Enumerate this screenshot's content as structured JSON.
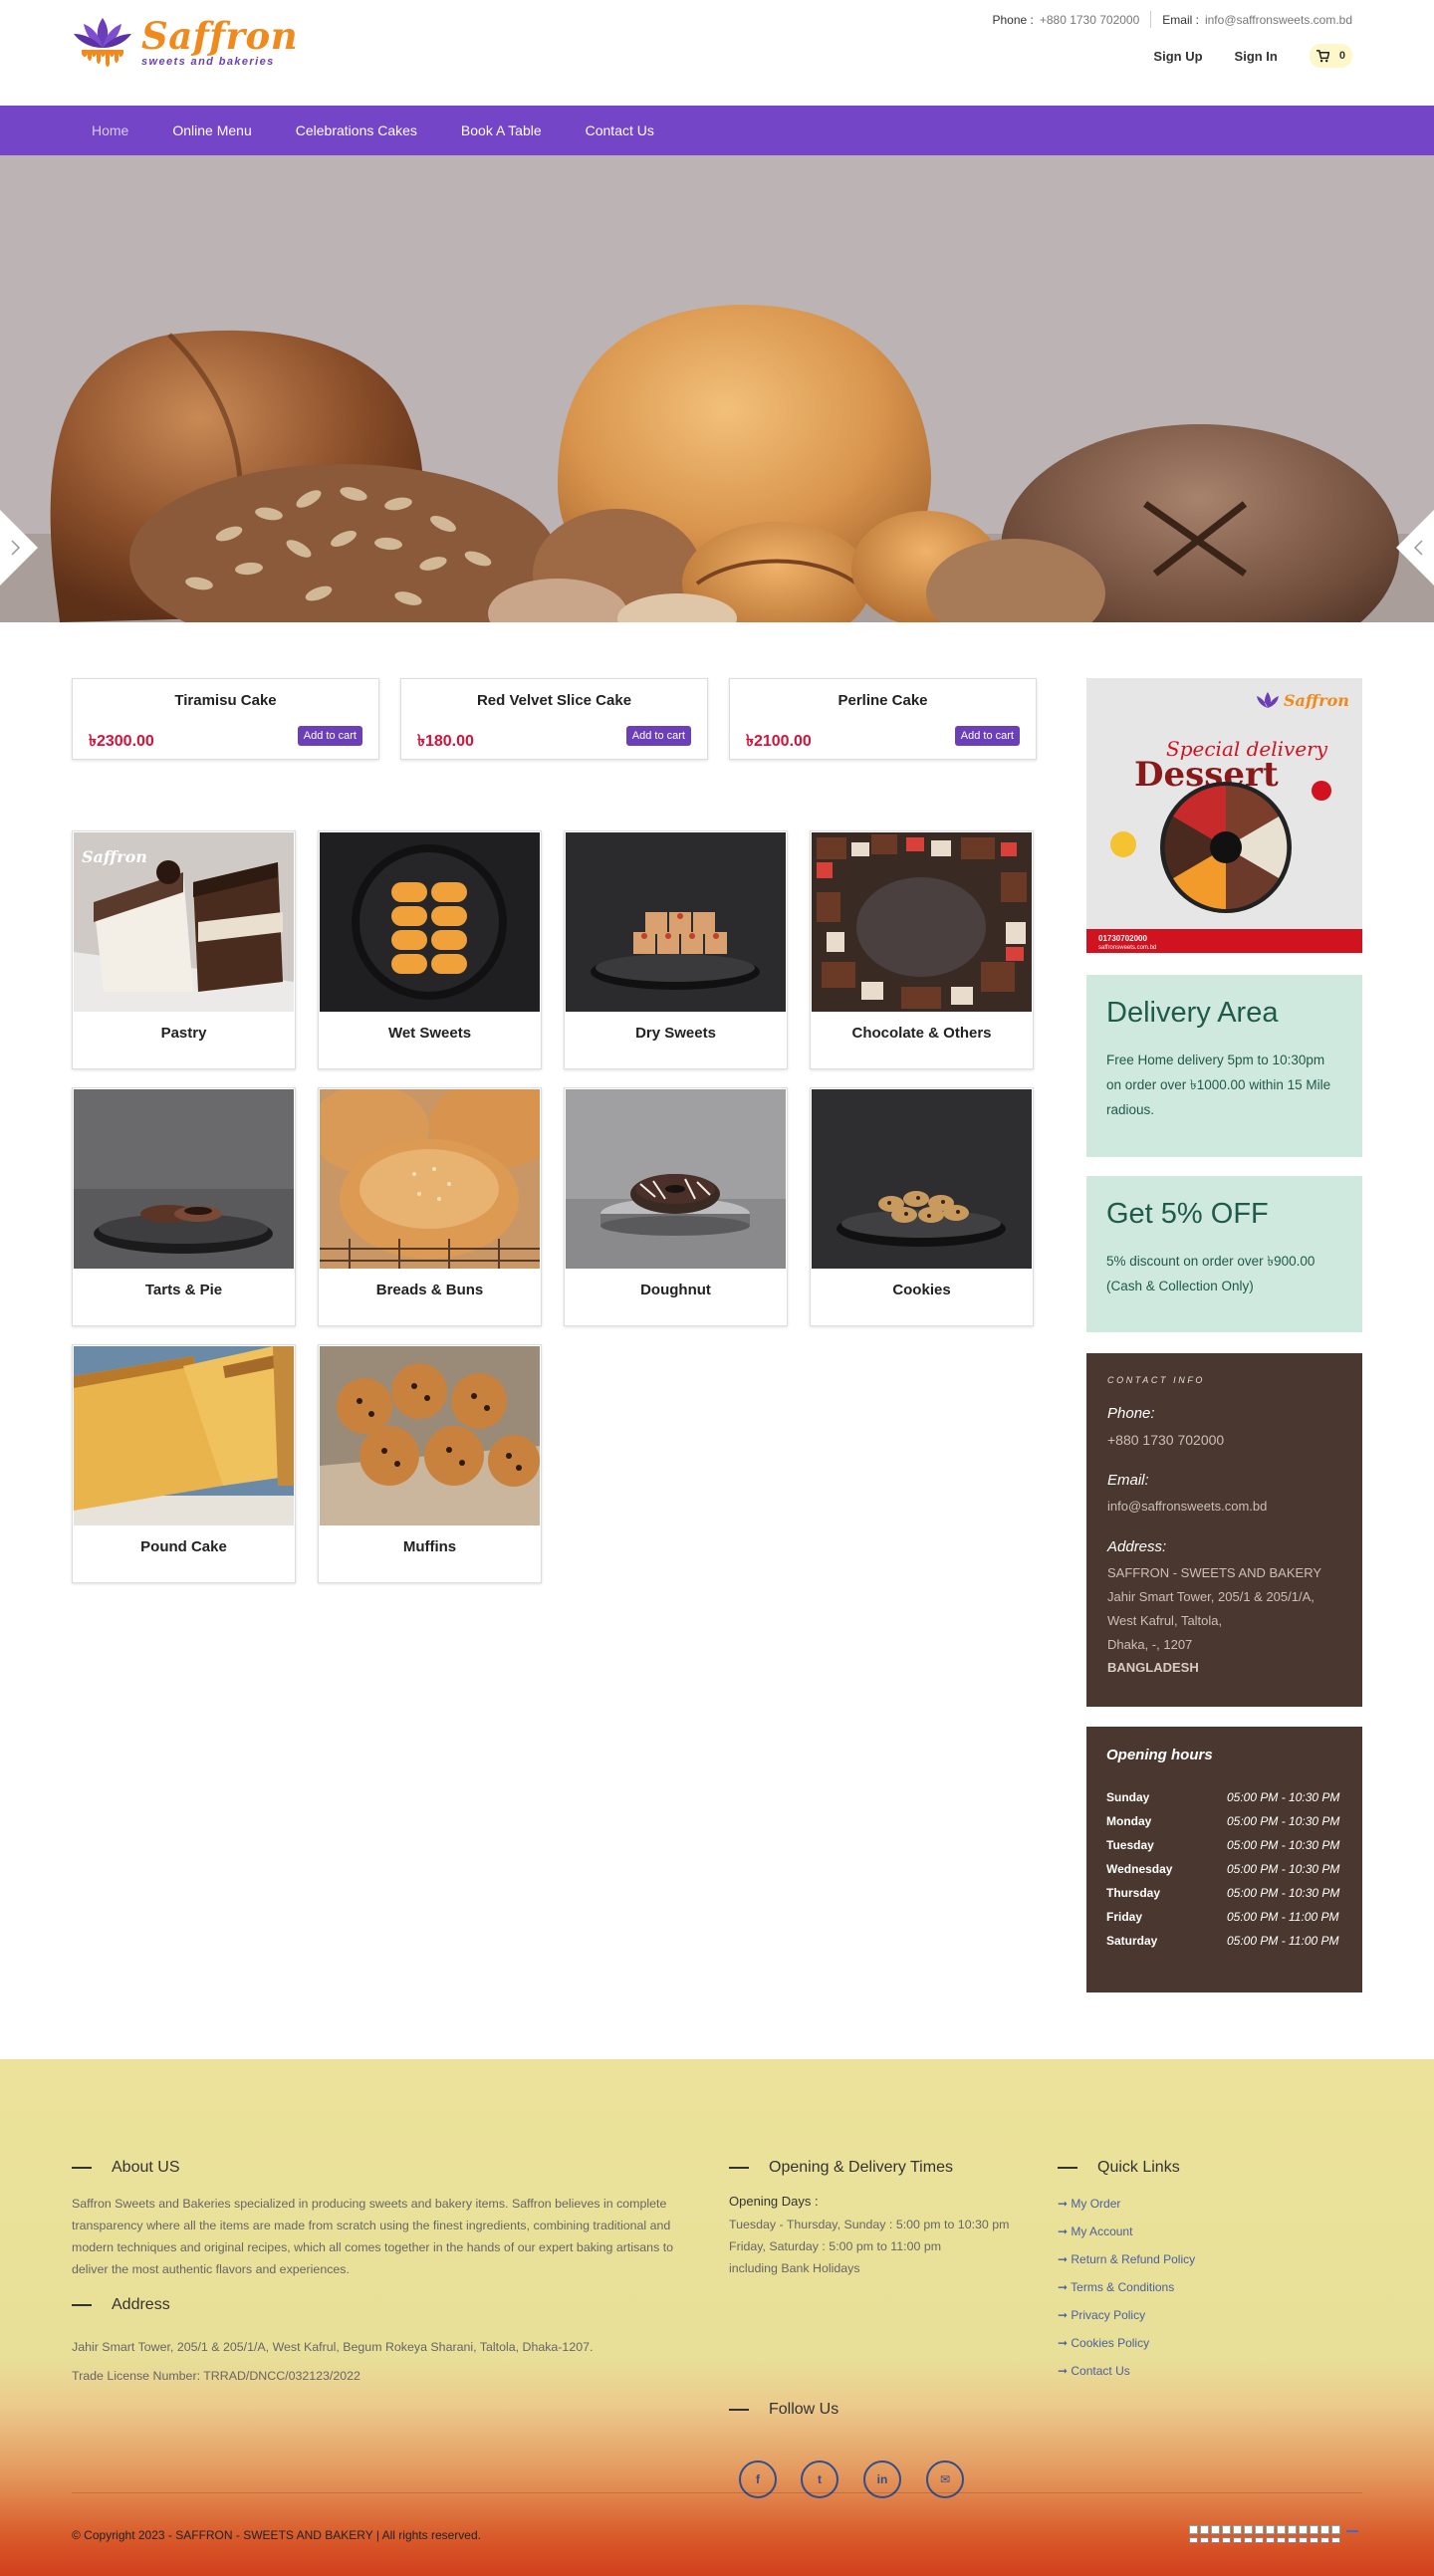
{
  "brand": {
    "name": "Saffron",
    "tagline": "sweets and bakeries"
  },
  "topbar": {
    "phone_label": "Phone :",
    "phone_value": "+880 1730 702000",
    "email_label": "Email :",
    "email_value": "info@saffronsweets.com.bd"
  },
  "account": {
    "signup": "Sign Up",
    "signin": "Sign In",
    "cart_count": "0",
    "cart_icon": "cart-icon"
  },
  "nav": [
    "Home",
    "Online Menu",
    "Celebrations Cakes",
    "Book A Table",
    "Contact Us"
  ],
  "hero": {
    "prev_icon": "chevron-right-icon",
    "next_icon": "chevron-left-icon"
  },
  "featured": [
    {
      "name": "Tiramisu Cake",
      "price": "৳2300.00",
      "button": "Add to cart"
    },
    {
      "name": "Red Velvet Slice Cake",
      "price": "৳180.00",
      "button": "Add to cart"
    },
    {
      "name": "Perline Cake",
      "price": "৳2100.00",
      "button": "Add to cart"
    }
  ],
  "categories": [
    "Pastry",
    "Wet Sweets",
    "Dry Sweets",
    "Chocolate & Others",
    "Tarts & Pie",
    "Breads & Buns",
    "Doughnut",
    "Cookies",
    "Pound Cake",
    "Muffins"
  ],
  "promo": {
    "title": "Special delivery",
    "headline": "Dessert",
    "phone": "01730702000",
    "site": "saffronsweets.com.bd",
    "brand": "Saffron"
  },
  "delivery": {
    "title": "Delivery Area",
    "text": "Free Home delivery 5pm to 10:30pm on order over ৳1000.00 within 15 Mile radious."
  },
  "discount": {
    "title": "Get 5% OFF",
    "text": "5% discount on order over ৳900.00 (Cash & Collection Only)"
  },
  "contact": {
    "heading": "CONTACT INFO",
    "phone_label": "Phone:",
    "phone": "+880 1730 702000",
    "email_label": "Email:",
    "email": "info@saffronsweets.com.bd",
    "address_label": "Address:",
    "address_lines": [
      "SAFFRON - SWEETS AND BAKERY",
      "Jahir Smart Tower, 205/1 & 205/1/A,",
      "West Kafrul, Taltola,",
      "Dhaka, -, 1207"
    ],
    "country": "BANGLADESH"
  },
  "hours": {
    "title": "Opening hours",
    "rows": [
      {
        "day": "Sunday",
        "time": "05:00 PM - 10:30 PM"
      },
      {
        "day": "Monday",
        "time": "05:00 PM - 10:30 PM"
      },
      {
        "day": "Tuesday",
        "time": "05:00 PM - 10:30 PM"
      },
      {
        "day": "Wednesday",
        "time": "05:00 PM - 10:30 PM"
      },
      {
        "day": "Thursday",
        "time": "05:00 PM - 10:30 PM"
      },
      {
        "day": "Friday",
        "time": "05:00 PM - 11:00 PM"
      },
      {
        "day": "Saturday",
        "time": "05:00 PM - 11:00 PM"
      }
    ]
  },
  "footer": {
    "about_title": "About US",
    "about_text": "Saffron Sweets and Bakeries specialized in producing sweets and bakery items. Saffron believes in complete transparency where all the items are made from scratch using the finest ingredients, combining traditional and modern techniques and original recipes, which all comes together in the hands of our expert baking artisans to deliver the most authentic flavors and experiences.",
    "address_title": "Address",
    "address_text": "Jahir Smart Tower, 205/1 & 205/1/A, West Kafrul, Begum Rokeya Sharani, Taltola, Dhaka-1207.",
    "license": "Trade License Number: TRRAD/DNCC/032123/2022",
    "times_title": "Opening & Delivery Times",
    "opening_days": "Opening Days :",
    "times_lines": [
      "Tuesday - Thursday, Sunday : 5:00 pm to 10:30 pm",
      "Friday, Saturday : 5:00 pm to 11:00 pm",
      "including Bank Holidays"
    ],
    "links_title": "Quick Links",
    "links": [
      "My Order",
      "My Account",
      "Return & Refund Policy",
      "Terms & Conditions",
      "Privacy Policy",
      "Cookies Policy",
      "Contact Us"
    ],
    "follow_title": "Follow Us",
    "social": [
      {
        "icon": "facebook-icon",
        "glyph": "f"
      },
      {
        "icon": "twitter-icon",
        "glyph": "t"
      },
      {
        "icon": "linkedin-icon",
        "glyph": "in"
      },
      {
        "icon": "email-icon",
        "glyph": "✉"
      }
    ],
    "copyright": "© Copyright 2023 - SAFFRON - SWEETS AND BAKERY | All rights reserved."
  },
  "colors": {
    "accent": "#7445c7",
    "price": "#d2143a",
    "brand_orange": "#f08a1c",
    "panel_green": "#d0e9df",
    "panel_brown": "#4a3830"
  }
}
